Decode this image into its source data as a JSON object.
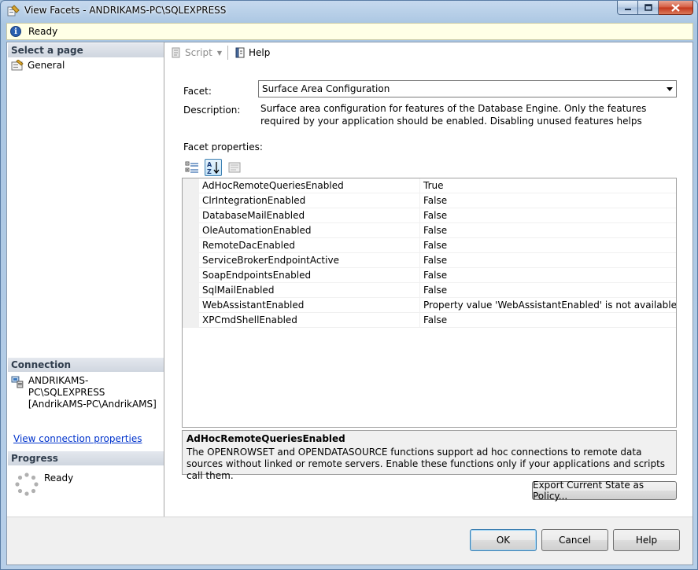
{
  "window": {
    "title": "View Facets - ANDRIKAMS-PC\\SQLEXPRESS"
  },
  "status": {
    "text": "Ready"
  },
  "left_pane": {
    "select_page_header": "Select a page",
    "pages": [
      {
        "label": "General"
      }
    ],
    "connection_header": "Connection",
    "connection_server": "ANDRIKAMS-PC\\SQLEXPRESS",
    "connection_user": "[AndrikAMS-PC\\AndrikAMS]",
    "view_connection_link": "View connection properties",
    "progress_header": "Progress",
    "progress_status": "Ready"
  },
  "toolbar": {
    "script_label": "Script",
    "help_label": "Help"
  },
  "facet": {
    "label": "Facet:",
    "selected": "Surface Area Configuration",
    "description_label": "Description:",
    "description": "Surface area configuration for features of the Database Engine. Only the features required by your application should be enabled. Disabling unused features helps protect your server by reducing the"
  },
  "facet_properties": {
    "label": "Facet properties:",
    "rows": [
      {
        "name": "AdHocRemoteQueriesEnabled",
        "value": "True"
      },
      {
        "name": "ClrIntegrationEnabled",
        "value": "False"
      },
      {
        "name": "DatabaseMailEnabled",
        "value": "False"
      },
      {
        "name": "OleAutomationEnabled",
        "value": "False"
      },
      {
        "name": "RemoteDacEnabled",
        "value": "False"
      },
      {
        "name": "ServiceBrokerEndpointActive",
        "value": "False"
      },
      {
        "name": "SoapEndpointsEnabled",
        "value": "False"
      },
      {
        "name": "SqlMailEnabled",
        "value": "False"
      },
      {
        "name": "WebAssistantEnabled",
        "value": "Property value 'WebAssistantEnabled' is not available."
      },
      {
        "name": "XPCmdShellEnabled",
        "value": "False"
      }
    ]
  },
  "help_panel": {
    "title": "AdHocRemoteQueriesEnabled",
    "text": "The OPENROWSET and OPENDATASOURCE functions support ad hoc connections to remote data sources without linked or remote servers. Enable these functions only if your applications and scripts call them."
  },
  "buttons": {
    "export": "Export Current State as Policy...",
    "ok": "OK",
    "cancel": "Cancel",
    "help": "Help"
  },
  "icons": {
    "title": "facets-icon",
    "info": "info-icon",
    "page": "general-page-icon",
    "connection": "server-connection-icon",
    "progress": "progress-spinner-icon",
    "script": "script-icon",
    "help": "help-book-icon",
    "categorized": "categorized-icon",
    "alphabetical": "alphabetical-sort-icon",
    "property_pages": "property-pages-icon"
  }
}
